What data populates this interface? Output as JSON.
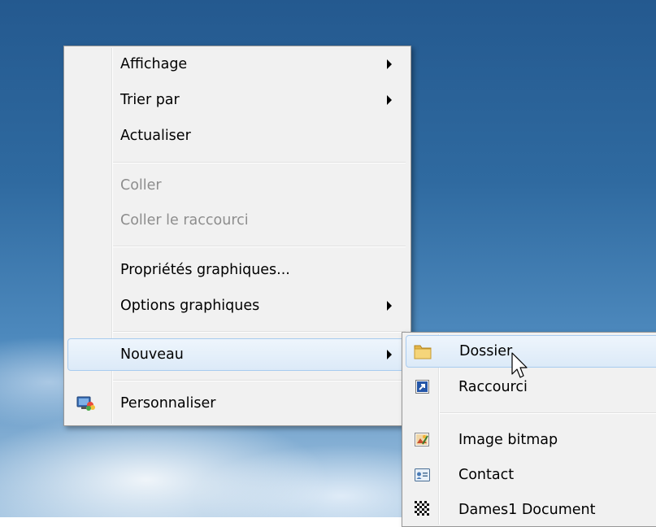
{
  "context_menu": {
    "items": [
      {
        "label": "Affichage",
        "submenu": true
      },
      {
        "label": "Trier par",
        "submenu": true
      },
      {
        "label": "Actualiser"
      },
      {
        "label": "Coller",
        "disabled": true
      },
      {
        "label": "Coller le raccourci",
        "disabled": true
      },
      {
        "label": "Propriétés graphiques..."
      },
      {
        "label": "Options graphiques",
        "submenu": true
      },
      {
        "label": "Nouveau",
        "submenu": true,
        "highlighted": true
      },
      {
        "label": "Personnaliser",
        "icon": "personalize-icon"
      }
    ]
  },
  "new_submenu": {
    "items": [
      {
        "label": "Dossier",
        "icon": "folder-icon",
        "highlighted": true
      },
      {
        "label": "Raccourci",
        "icon": "shortcut-icon"
      },
      {
        "label": "Image bitmap",
        "icon": "bitmap-icon"
      },
      {
        "label": "Contact",
        "icon": "contact-icon"
      },
      {
        "label": "Dames1 Document",
        "icon": "checkerboard-icon"
      }
    ]
  },
  "colors": {
    "menu_background": "#f1f1f1",
    "highlight_border": "#a8cbef",
    "disabled_text": "#8d8d8d"
  }
}
